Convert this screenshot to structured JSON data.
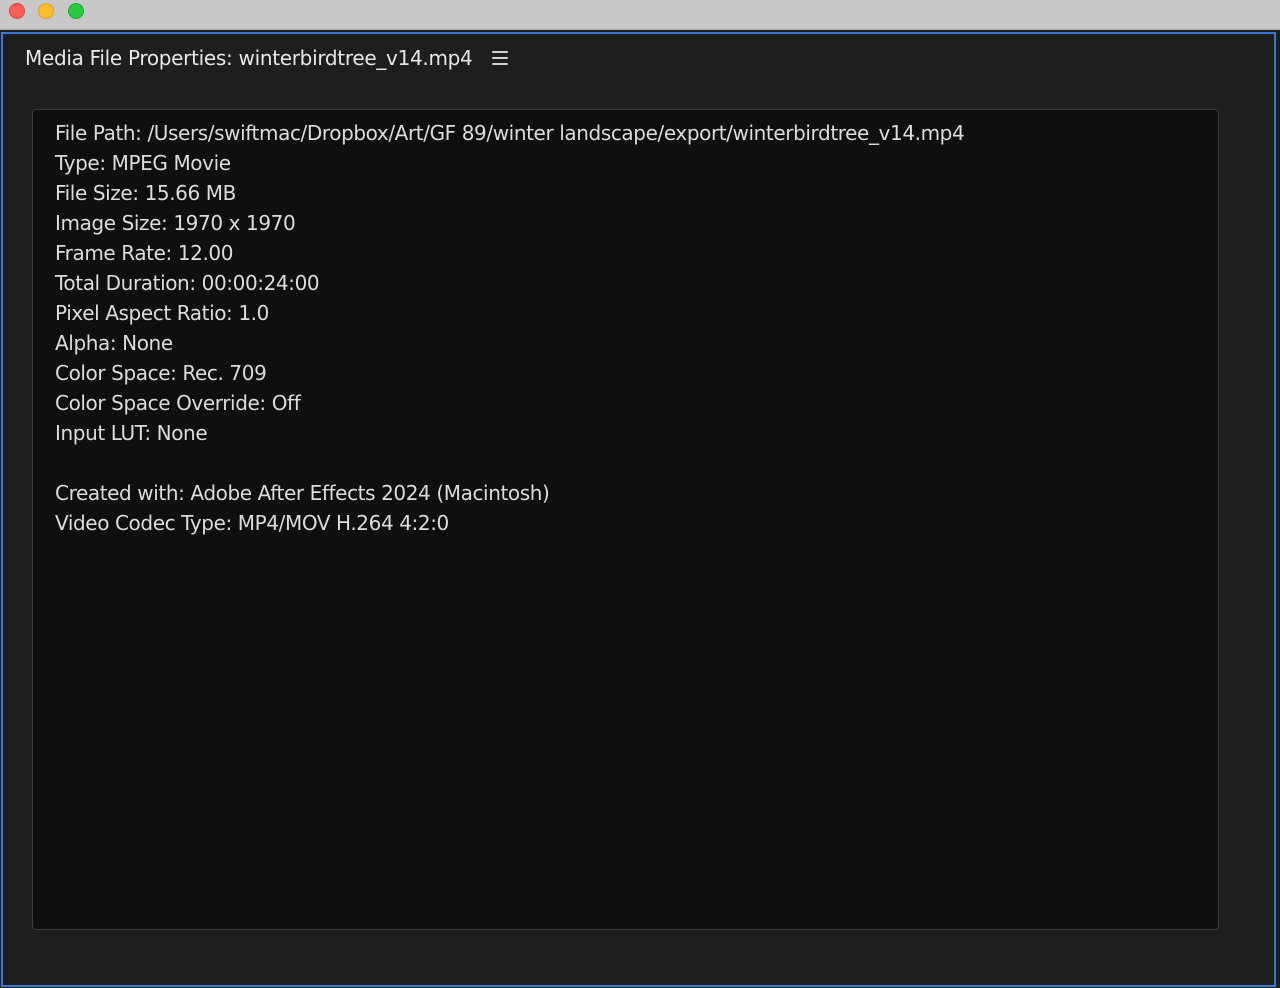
{
  "panel": {
    "title": "Media File Properties: winterbirdtree_v14.mp4",
    "menu_icon": "hamburger-menu-icon"
  },
  "window_controls": {
    "close_color": "#fe5f57",
    "minimize_color": "#febc2e",
    "maximize_color": "#28c840"
  },
  "properties": {
    "file_path": "File Path: /Users/swiftmac/Dropbox/Art/GF 89/winter landscape/export/winterbirdtree_v14.mp4",
    "type": "Type: MPEG Movie",
    "file_size": "File Size: 15.66 MB",
    "image_size": "Image Size: 1970 x 1970",
    "frame_rate": "Frame Rate: 12.00",
    "total_duration": "Total Duration: 00:00:24:00",
    "pixel_aspect_ratio": "Pixel Aspect Ratio: 1.0",
    "alpha": "Alpha: None",
    "color_space": "Color Space: Rec. 709",
    "color_space_override": "Color Space Override: Off",
    "input_lut": "Input LUT: None",
    "created_with": "Created with: Adobe After Effects 2024 (Macintosh)",
    "video_codec_type": "Video Codec Type: MP4/MOV H.264 4:2:0"
  },
  "colors": {
    "accent_border": "#3a78d4",
    "panel_bg": "#1e1e1e",
    "info_bg": "#0f0f0f"
  }
}
